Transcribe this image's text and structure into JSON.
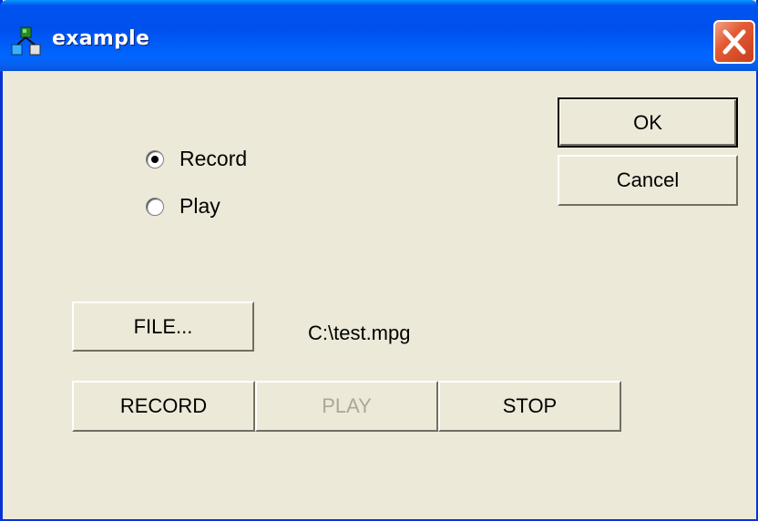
{
  "window": {
    "title": "example",
    "icon": "application-icon",
    "close_icon": "close-x-icon"
  },
  "dialog": {
    "ok_label": "OK",
    "cancel_label": "Cancel"
  },
  "mode": {
    "options": [
      {
        "label": "Record",
        "selected": true
      },
      {
        "label": "Play",
        "selected": false
      }
    ]
  },
  "file": {
    "button_label": "FILE...",
    "path": "C:\\test.mpg"
  },
  "controls": {
    "record_label": "RECORD",
    "play_label": "PLAY",
    "play_enabled": false,
    "stop_label": "STOP"
  },
  "colors": {
    "titlebar": "#0053ee",
    "face": "#ece9d8",
    "close": "#e35a34",
    "disabled_text": "#aca899"
  }
}
